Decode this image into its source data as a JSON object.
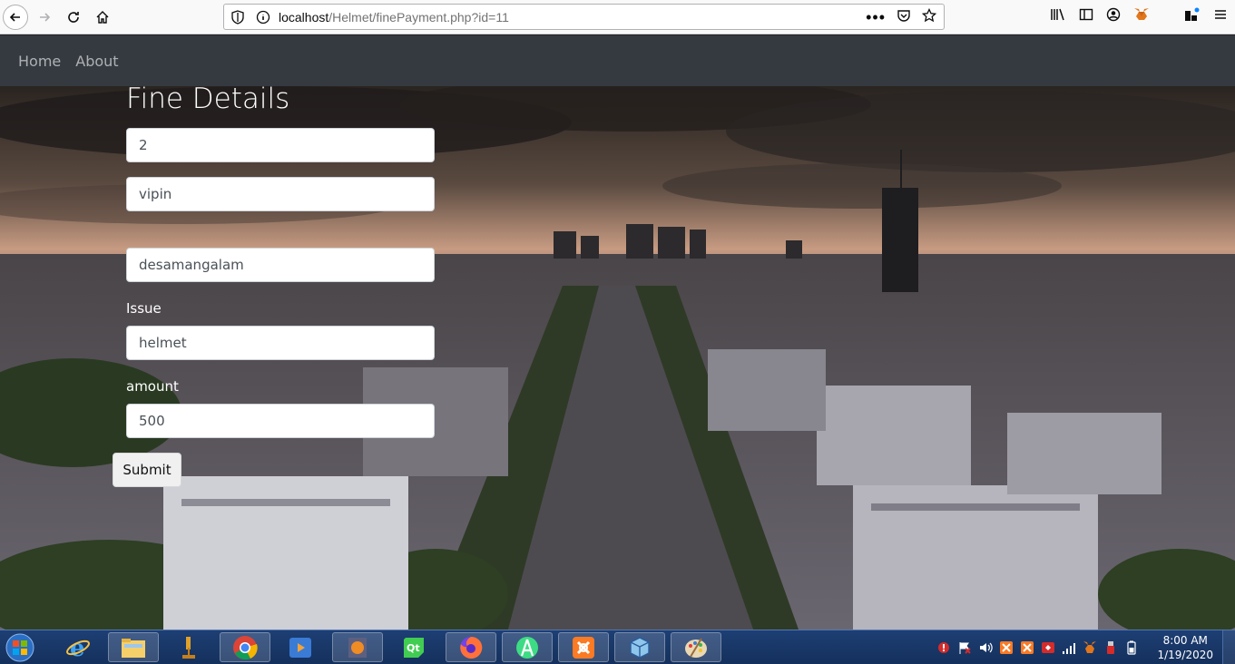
{
  "browser": {
    "url_host": "localhost",
    "url_path": "/Helmet/finePayment.php?id=11",
    "url_actions": [
      "more-icon",
      "pocket-icon",
      "bookmark-star-icon"
    ],
    "toolbar_icons": [
      "library-icon",
      "sidebar-icon",
      "account-icon",
      "metamask-icon",
      "extensions-icon",
      "menu-icon"
    ]
  },
  "navbar": {
    "items": [
      {
        "label": "Home"
      },
      {
        "label": "About"
      }
    ]
  },
  "form": {
    "title": "Fine Details",
    "fields": [
      {
        "label": "",
        "value": "2"
      },
      {
        "label": "",
        "value": "vipin"
      },
      {
        "label": "",
        "value": "desamangalam"
      },
      {
        "label": "Issue",
        "value": "helmet"
      },
      {
        "label": "amount",
        "value": "500"
      }
    ],
    "submit_label": "Submit"
  },
  "taskbar": {
    "apps": [
      "start-orb",
      "internet-explorer",
      "file-explorer",
      "tool-app",
      "chrome",
      "media-player",
      "vlc-like",
      "qt-creator",
      "firefox",
      "android-studio",
      "xampp",
      "virtualbox",
      "paint"
    ],
    "clock_time": "8:00 AM",
    "clock_date": "1/19/2020"
  },
  "colors": {
    "navbar_bg": "#343a40",
    "taskbar_bg": "#1e3f74"
  }
}
